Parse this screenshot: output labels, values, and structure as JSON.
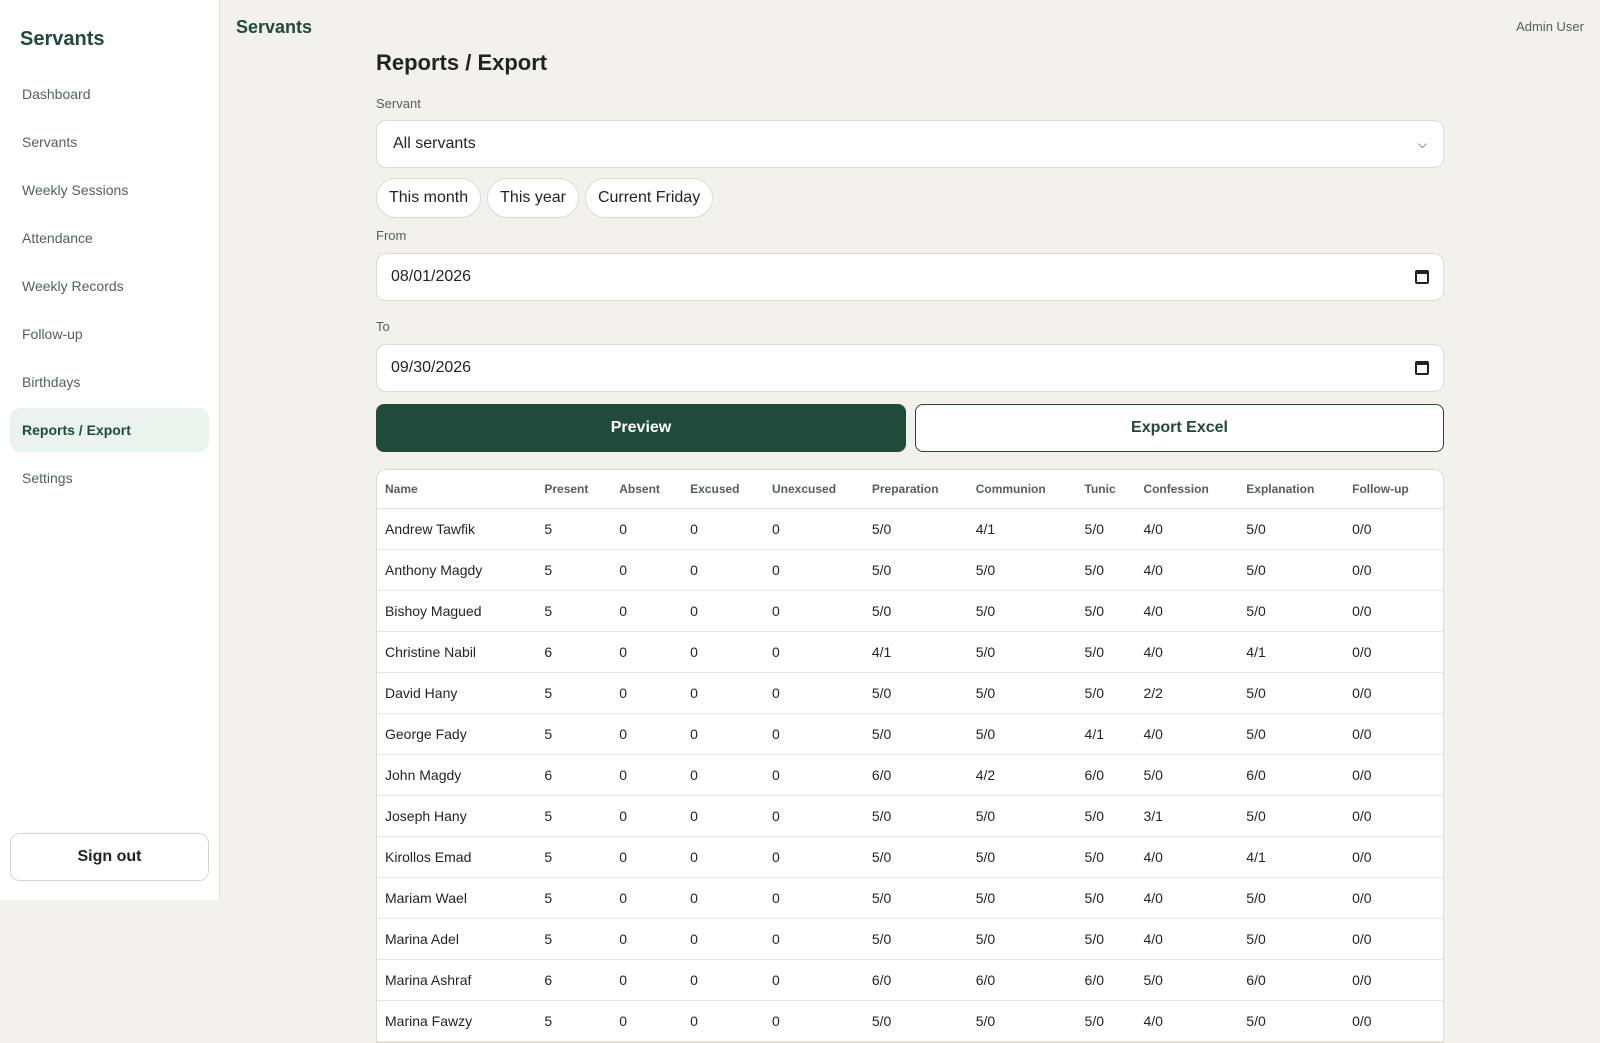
{
  "sidebar": {
    "brand": "Servants",
    "items": [
      {
        "label": "Dashboard",
        "name": "sidebar-item-dashboard",
        "active": false
      },
      {
        "label": "Servants",
        "name": "sidebar-item-servants",
        "active": false
      },
      {
        "label": "Weekly Sessions",
        "name": "sidebar-item-weekly-sessions",
        "active": false
      },
      {
        "label": "Attendance",
        "name": "sidebar-item-attendance",
        "active": false
      },
      {
        "label": "Weekly Records",
        "name": "sidebar-item-weekly-records",
        "active": false
      },
      {
        "label": "Follow-up",
        "name": "sidebar-item-follow-up",
        "active": false
      },
      {
        "label": "Birthdays",
        "name": "sidebar-item-birthdays",
        "active": false
      },
      {
        "label": "Reports / Export",
        "name": "sidebar-item-reports-export",
        "active": true
      },
      {
        "label": "Settings",
        "name": "sidebar-item-settings",
        "active": false
      }
    ],
    "signout_label": "Sign out"
  },
  "header": {
    "title": "Servants",
    "user": "Admin User"
  },
  "main": {
    "title": "Reports / Export",
    "servant_label": "Servant",
    "servant_value": "All servants",
    "quick_ranges": [
      "This month",
      "This year",
      "Current Friday"
    ],
    "from_label": "From",
    "from_value": "08/01/2026",
    "to_label": "To",
    "to_value": "09/30/2026",
    "preview_label": "Preview",
    "export_label": "Export Excel"
  },
  "table": {
    "columns": [
      "Name",
      "Present",
      "Absent",
      "Excused",
      "Unexcused",
      "Preparation",
      "Communion",
      "Tunic",
      "Confession",
      "Explanation",
      "Follow-up"
    ],
    "rows": [
      [
        "Andrew Tawfik",
        "5",
        "0",
        "0",
        "0",
        "5/0",
        "4/1",
        "5/0",
        "4/0",
        "5/0",
        "0/0"
      ],
      [
        "Anthony Magdy",
        "5",
        "0",
        "0",
        "0",
        "5/0",
        "5/0",
        "5/0",
        "4/0",
        "5/0",
        "0/0"
      ],
      [
        "Bishoy Magued",
        "5",
        "0",
        "0",
        "0",
        "5/0",
        "5/0",
        "5/0",
        "4/0",
        "5/0",
        "0/0"
      ],
      [
        "Christine Nabil",
        "6",
        "0",
        "0",
        "0",
        "4/1",
        "5/0",
        "5/0",
        "4/0",
        "4/1",
        "0/0"
      ],
      [
        "David Hany",
        "5",
        "0",
        "0",
        "0",
        "5/0",
        "5/0",
        "5/0",
        "2/2",
        "5/0",
        "0/0"
      ],
      [
        "George Fady",
        "5",
        "0",
        "0",
        "0",
        "5/0",
        "5/0",
        "4/1",
        "4/0",
        "5/0",
        "0/0"
      ],
      [
        "John Magdy",
        "6",
        "0",
        "0",
        "0",
        "6/0",
        "4/2",
        "6/0",
        "5/0",
        "6/0",
        "0/0"
      ],
      [
        "Joseph Hany",
        "5",
        "0",
        "0",
        "0",
        "5/0",
        "5/0",
        "5/0",
        "3/1",
        "5/0",
        "0/0"
      ],
      [
        "Kirollos Emad",
        "5",
        "0",
        "0",
        "0",
        "5/0",
        "5/0",
        "5/0",
        "4/0",
        "4/1",
        "0/0"
      ],
      [
        "Mariam Wael",
        "5",
        "0",
        "0",
        "0",
        "5/0",
        "5/0",
        "5/0",
        "4/0",
        "5/0",
        "0/0"
      ],
      [
        "Marina Adel",
        "5",
        "0",
        "0",
        "0",
        "5/0",
        "5/0",
        "5/0",
        "4/0",
        "5/0",
        "0/0"
      ],
      [
        "Marina Ashraf",
        "6",
        "0",
        "0",
        "0",
        "6/0",
        "6/0",
        "6/0",
        "5/0",
        "6/0",
        "0/0"
      ],
      [
        "Marina Fawzy",
        "5",
        "0",
        "0",
        "0",
        "5/0",
        "5/0",
        "5/0",
        "4/0",
        "5/0",
        "0/0"
      ]
    ]
  }
}
